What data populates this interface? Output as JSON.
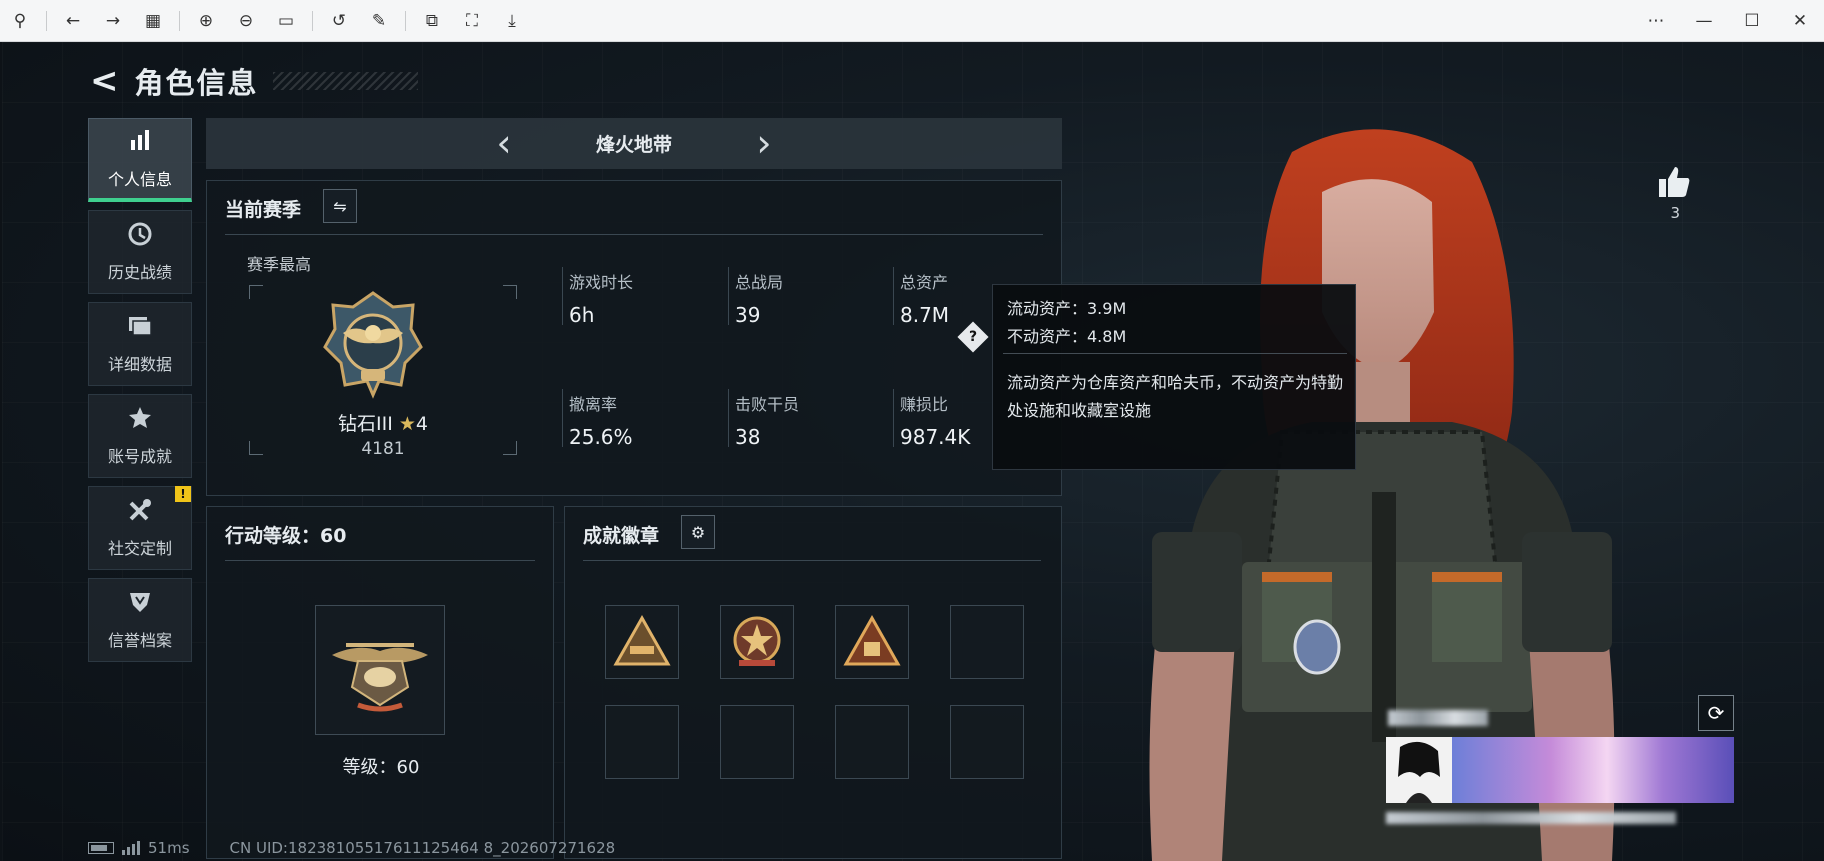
{
  "titlebar": {
    "left_icons": [
      "pin-icon",
      "back-arrow-icon",
      "forward-arrow-icon",
      "grid-icon",
      "zoom-in-icon",
      "zoom-out-icon",
      "fit-icon",
      "rotate-icon",
      "edit-icon",
      "copy-icon",
      "crop-icon",
      "save-icon"
    ],
    "right_icons": [
      "more-icon",
      "minimize-icon",
      "maximize-icon",
      "close-icon"
    ]
  },
  "header": {
    "title": "角色信息"
  },
  "sidebar": {
    "items": [
      {
        "label": "个人信息",
        "icon": "bar-chart-icon",
        "active": true
      },
      {
        "label": "历史战绩",
        "icon": "clock-icon",
        "active": false
      },
      {
        "label": "详细数据",
        "icon": "folder-icon",
        "active": false
      },
      {
        "label": "账号成就",
        "icon": "medal-icon",
        "active": false
      },
      {
        "label": "社交定制",
        "icon": "tools-icon",
        "active": false,
        "badge": "!"
      },
      {
        "label": "信誉档案",
        "icon": "shield-icon",
        "active": false
      }
    ]
  },
  "mode": {
    "name": "烽火地带"
  },
  "season": {
    "title": "当前赛季",
    "best_label": "赛季最高",
    "rank_name": "钻石III",
    "rank_stars": "4",
    "rank_points": "4181",
    "stats": [
      {
        "label": "游戏时长",
        "value": "6h"
      },
      {
        "label": "总战局",
        "value": "39"
      },
      {
        "label": "总资产",
        "value": "8.7M"
      },
      {
        "label": "撤离率",
        "value": "25.6%"
      },
      {
        "label": "击败干员",
        "value": "38"
      },
      {
        "label": "赚损比",
        "value": "987.4K"
      }
    ]
  },
  "tooltip": {
    "liquid": "流动资产：3.9M",
    "fixed": "不动资产：4.8M",
    "note": "流动资产为仓库资产和哈夫币，不动资产为特勤处设施和收藏室设施"
  },
  "action_level": {
    "title": "行动等级：60",
    "level_text": "等级：60"
  },
  "badges": {
    "title": "成就徽章",
    "filled": 3,
    "total": 8
  },
  "likes": {
    "count": "3"
  },
  "footer": {
    "ping": "51ms",
    "uid": "CN UID:18238105517611125464 8_202607271628"
  },
  "colors": {
    "accent": "#3fd08f",
    "warning": "#f0c419",
    "hair": "#b7341c"
  }
}
